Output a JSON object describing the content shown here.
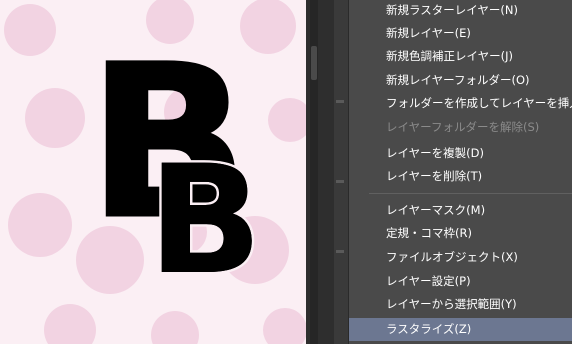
{
  "canvas": {
    "letter": "B",
    "background_color": "#fbeff4",
    "dot_color": "#f1cfe0"
  },
  "menu": {
    "items": [
      {
        "label": "新規ラスターレイヤー(N)",
        "state": "enabled"
      },
      {
        "label": "新規レイヤー(E)",
        "state": "enabled"
      },
      {
        "label": "新規色調補正レイヤー(J)",
        "state": "enabled"
      },
      {
        "label": "新規レイヤーフォルダー(O)",
        "state": "enabled"
      },
      {
        "label": "フォルダーを作成してレイヤーを挿入(F)",
        "state": "enabled"
      },
      {
        "label": "レイヤーフォルダーを解除(S)",
        "state": "disabled"
      },
      {
        "label": "レイヤーを複製(D)",
        "state": "enabled"
      },
      {
        "label": "レイヤーを削除(T)",
        "state": "enabled"
      },
      {
        "label": "レイヤーマスク(M)",
        "state": "enabled"
      },
      {
        "label": "定規・コマ枠(R)",
        "state": "enabled"
      },
      {
        "label": "ファイルオブジェクト(X)",
        "state": "enabled"
      },
      {
        "label": "レイヤー設定(P)",
        "state": "enabled"
      },
      {
        "label": "レイヤーから選択範囲(Y)",
        "state": "enabled"
      },
      {
        "label": "ラスタライズ(Z)",
        "state": "highlighted"
      }
    ],
    "highlight_color": "#6c7791",
    "background_color": "#4a4a4a"
  }
}
